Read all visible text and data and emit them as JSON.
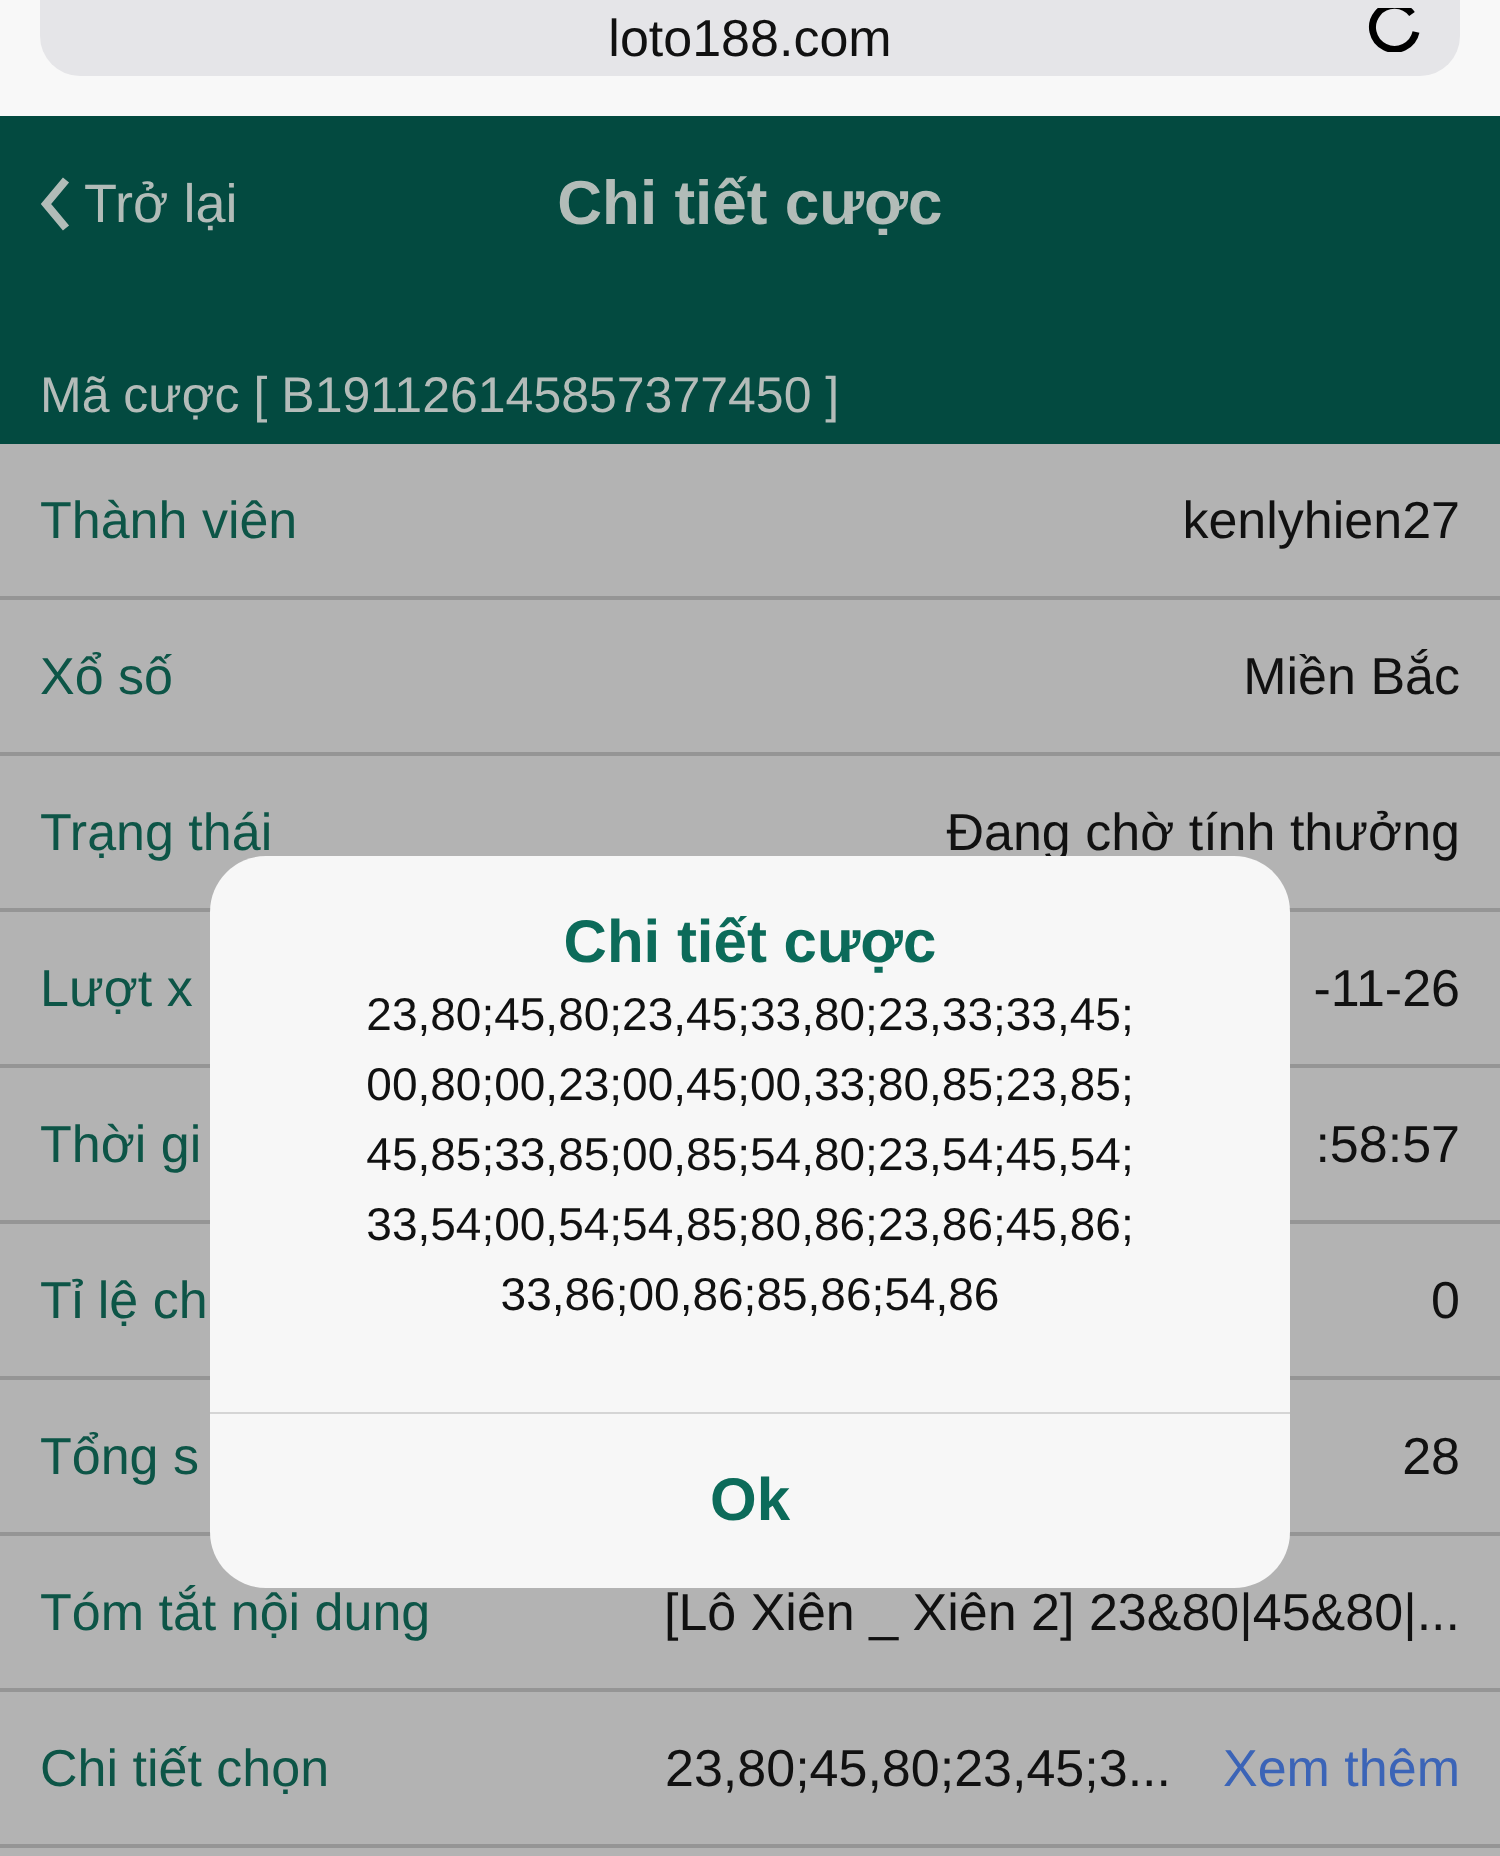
{
  "browser": {
    "address": "loto188.com"
  },
  "header": {
    "back": "Trở lại",
    "title": "Chi tiết cược",
    "bet_code": "Mã cược [ B191126145857377450 ]"
  },
  "rows": [
    {
      "label": "Thành viên",
      "value": "kenlyhien27"
    },
    {
      "label": "Xổ số",
      "value": "Miền Bắc"
    },
    {
      "label": "Trạng thái",
      "value": "Đang chờ tính thưởng"
    },
    {
      "label": "Lượt x",
      "value": "-11-26"
    },
    {
      "label": "Thời gi",
      "value": ":58:57"
    },
    {
      "label": "Tỉ lệ ch",
      "value": "0"
    },
    {
      "label": "Tổng s",
      "value": "28"
    },
    {
      "label": "Tóm tắt nội dung",
      "value": "[Lô Xiên _ Xiên 2] 23&80|45&80|..."
    },
    {
      "label": "Chi tiết chọn",
      "value": "23,80;45,80;23,45;3...",
      "link": "Xem thêm"
    }
  ],
  "dialog": {
    "title": "Chi tiết cược",
    "message": "23,80;45,80;23,45;33,80;23,33;33,45;\n00,80;00,23;00,45;00,33;80,85;23,85;\n45,85;33,85;00,85;54,80;23,54;45,54;\n33,54;00,54;54,85;80,86;23,86;45,86;\n33,86;00,86;85,86;54,86",
    "button": "Ok"
  }
}
